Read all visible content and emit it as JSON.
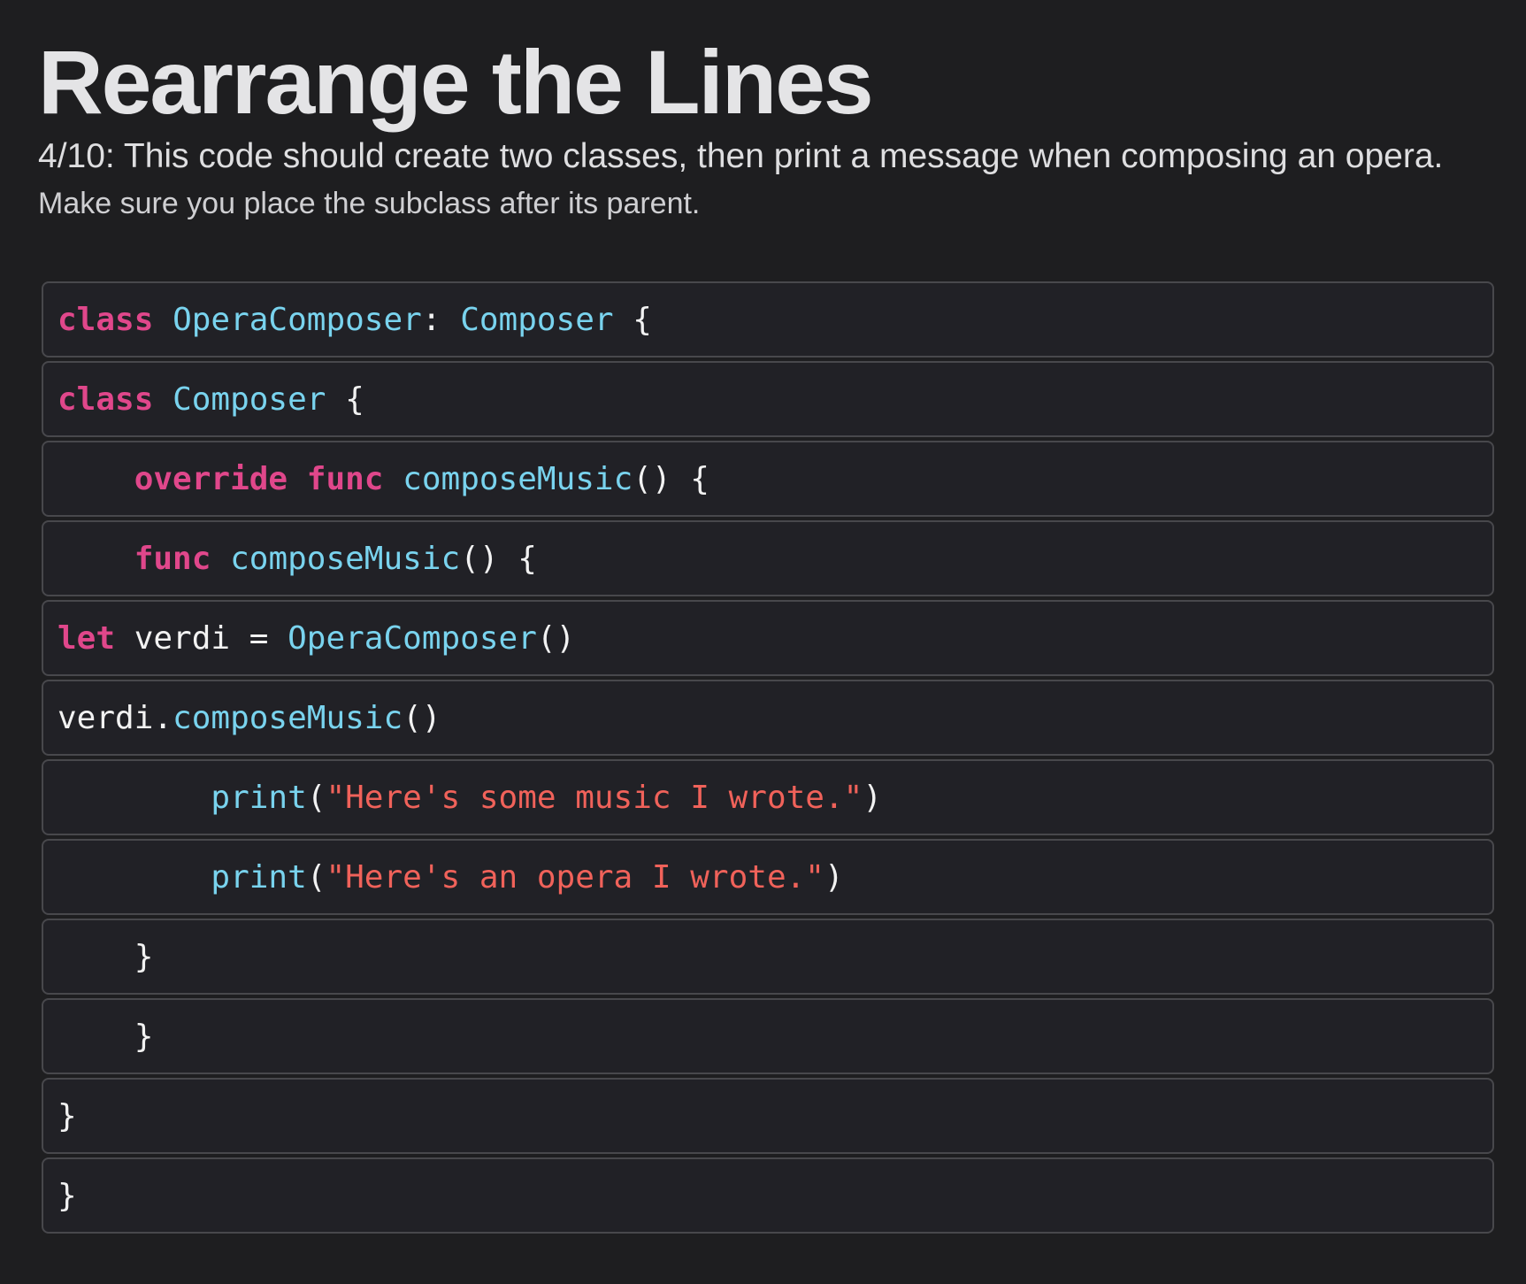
{
  "header": {
    "title": "Rearrange the Lines",
    "subtitle": "4/10: This code should create two classes, then print a message when composing an opera.",
    "instruction": "Make sure you place the subclass after its parent."
  },
  "colors": {
    "background": "#1e1e20",
    "line_background": "#212126",
    "line_border": "#48484c",
    "keyword": "#e0478b",
    "type": "#79d3ee",
    "string": "#f0625a",
    "plain": "#f2f2f2"
  },
  "code_lines": [
    {
      "id": "line-1",
      "tokens": [
        {
          "t": "kw",
          "v": "class"
        },
        {
          "t": "plain",
          "v": " "
        },
        {
          "t": "type",
          "v": "OperaComposer"
        },
        {
          "t": "plain",
          "v": ": "
        },
        {
          "t": "type",
          "v": "Composer"
        },
        {
          "t": "plain",
          "v": " {"
        }
      ]
    },
    {
      "id": "line-2",
      "tokens": [
        {
          "t": "kw",
          "v": "class"
        },
        {
          "t": "plain",
          "v": " "
        },
        {
          "t": "type",
          "v": "Composer"
        },
        {
          "t": "plain",
          "v": " {"
        }
      ]
    },
    {
      "id": "line-3",
      "tokens": [
        {
          "t": "plain",
          "v": "    "
        },
        {
          "t": "kw",
          "v": "override"
        },
        {
          "t": "plain",
          "v": " "
        },
        {
          "t": "kw",
          "v": "func"
        },
        {
          "t": "plain",
          "v": " "
        },
        {
          "t": "fn",
          "v": "composeMusic"
        },
        {
          "t": "plain",
          "v": "() {"
        }
      ]
    },
    {
      "id": "line-4",
      "tokens": [
        {
          "t": "plain",
          "v": "    "
        },
        {
          "t": "kw",
          "v": "func"
        },
        {
          "t": "plain",
          "v": " "
        },
        {
          "t": "fn",
          "v": "composeMusic"
        },
        {
          "t": "plain",
          "v": "() {"
        }
      ]
    },
    {
      "id": "line-5",
      "tokens": [
        {
          "t": "kw",
          "v": "let"
        },
        {
          "t": "plain",
          "v": " verdi = "
        },
        {
          "t": "type",
          "v": "OperaComposer"
        },
        {
          "t": "plain",
          "v": "()"
        }
      ]
    },
    {
      "id": "line-6",
      "tokens": [
        {
          "t": "plain",
          "v": "verdi."
        },
        {
          "t": "fn",
          "v": "composeMusic"
        },
        {
          "t": "plain",
          "v": "()"
        }
      ]
    },
    {
      "id": "line-7",
      "tokens": [
        {
          "t": "plain",
          "v": "        "
        },
        {
          "t": "fn",
          "v": "print"
        },
        {
          "t": "plain",
          "v": "("
        },
        {
          "t": "str",
          "v": "\"Here's some music I wrote.\""
        },
        {
          "t": "plain",
          "v": ")"
        }
      ]
    },
    {
      "id": "line-8",
      "tokens": [
        {
          "t": "plain",
          "v": "        "
        },
        {
          "t": "fn",
          "v": "print"
        },
        {
          "t": "plain",
          "v": "("
        },
        {
          "t": "str",
          "v": "\"Here's an opera I wrote.\""
        },
        {
          "t": "plain",
          "v": ")"
        }
      ]
    },
    {
      "id": "line-9",
      "tokens": [
        {
          "t": "plain",
          "v": "    }"
        }
      ]
    },
    {
      "id": "line-10",
      "tokens": [
        {
          "t": "plain",
          "v": "    }"
        }
      ]
    },
    {
      "id": "line-11",
      "tokens": [
        {
          "t": "plain",
          "v": "}"
        }
      ]
    },
    {
      "id": "line-12",
      "tokens": [
        {
          "t": "plain",
          "v": "}"
        }
      ]
    }
  ]
}
